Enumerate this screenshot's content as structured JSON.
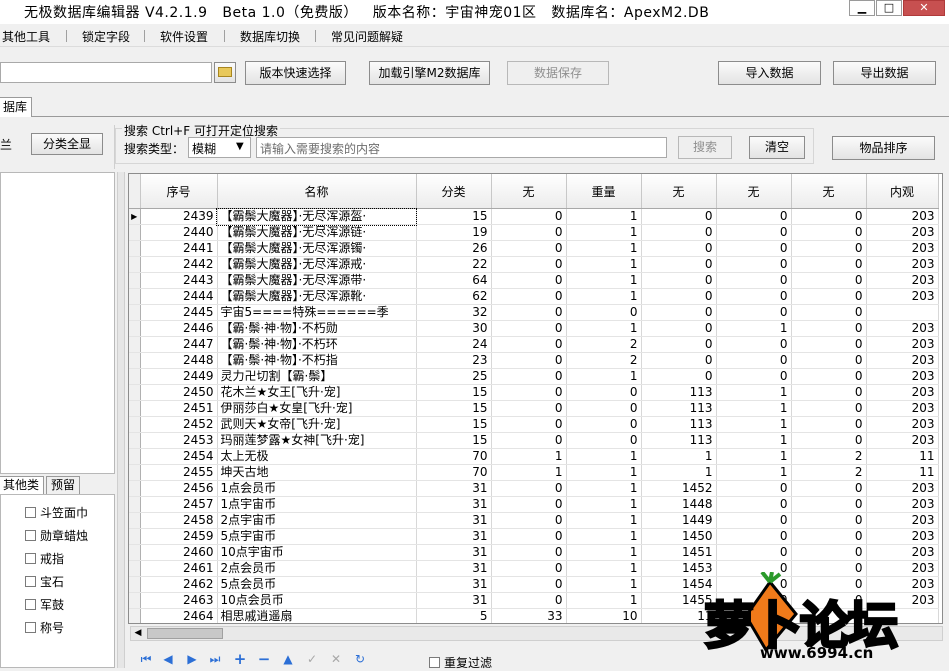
{
  "window": {
    "title": "无极数据库编辑器 V4.2.1.9   Beta 1.0（免费版）   版本名称：宇宙神宠01区   数据库名：ApexM2.DB",
    "minimize": "▁",
    "maximize": "□",
    "close": "✕"
  },
  "menu": [
    "其他工具",
    "锁定字段",
    "软件设置",
    "数据库切换",
    "常见问题解疑"
  ],
  "toolbar": {
    "folder_icon": "folder-icon",
    "version_select": "版本快速选择",
    "load_engine": "加载引擎M2数据库",
    "save_data": "数据保存",
    "import": "导入数据",
    "export": "导出数据"
  },
  "tab_db": "据库",
  "left_panel": {
    "label_fragment": "兰",
    "show_all": "分类全显",
    "tabs": [
      "其他类",
      "预留"
    ],
    "checkboxes": [
      "斗笠面巾",
      "勋章蜡烛",
      "戒指",
      "宝石",
      "军鼓",
      "称号"
    ]
  },
  "search": {
    "hint": "搜索  Ctrl+F 可打开定位搜索",
    "type_label": "搜索类型：",
    "type_value": "模糊",
    "placeholder": "请输入需要搜索的内容",
    "search_button": "搜索",
    "clear_button": "清空",
    "sort_button": "物品排序"
  },
  "table": {
    "columns": [
      "序号",
      "名称",
      "分类",
      "无",
      "重量",
      "无",
      "无",
      "无",
      "内观"
    ],
    "rows": [
      [
        "2439",
        "【霸鬃大魔器】·无尽浑源盔·",
        "15",
        "0",
        "1",
        "0",
        "0",
        "0",
        "203"
      ],
      [
        "2440",
        "【霸鬃大魔器】·无尽浑源链·",
        "19",
        "0",
        "1",
        "0",
        "0",
        "0",
        "203"
      ],
      [
        "2441",
        "【霸鬃大魔器】·无尽浑源镯·",
        "26",
        "0",
        "1",
        "0",
        "0",
        "0",
        "203"
      ],
      [
        "2442",
        "【霸鬃大魔器】·无尽浑源戒·",
        "22",
        "0",
        "1",
        "0",
        "0",
        "0",
        "203"
      ],
      [
        "2443",
        "【霸鬃大魔器】·无尽浑源带·",
        "64",
        "0",
        "1",
        "0",
        "0",
        "0",
        "203"
      ],
      [
        "2444",
        "【霸鬃大魔器】·无尽浑源靴·",
        "62",
        "0",
        "1",
        "0",
        "0",
        "0",
        "203"
      ],
      [
        "2445",
        "宇宙5====特殊======季",
        "32",
        "0",
        "0",
        "0",
        "0",
        "0",
        ""
      ],
      [
        "2446",
        "【霸·鬃·神·物】·不朽勋",
        "30",
        "0",
        "1",
        "0",
        "1",
        "0",
        "203"
      ],
      [
        "2447",
        "【霸·鬃·神·物】·不朽环",
        "24",
        "0",
        "2",
        "0",
        "0",
        "0",
        "203"
      ],
      [
        "2448",
        "【霸·鬃·神·物】·不朽指",
        "23",
        "0",
        "2",
        "0",
        "0",
        "0",
        "203"
      ],
      [
        "2449",
        "灵力卍切割【霸·鬃】",
        "25",
        "0",
        "1",
        "0",
        "0",
        "0",
        "203"
      ],
      [
        "2450",
        "花木兰★女王[飞升·宠]",
        "15",
        "0",
        "0",
        "113",
        "1",
        "0",
        "203"
      ],
      [
        "2451",
        "伊丽莎白★女皇[飞升·宠]",
        "15",
        "0",
        "0",
        "113",
        "1",
        "0",
        "203"
      ],
      [
        "2452",
        "武则天★女帝[飞升·宠]",
        "15",
        "0",
        "0",
        "113",
        "1",
        "0",
        "203"
      ],
      [
        "2453",
        "玛丽莲梦露★女神[飞升·宠]",
        "15",
        "0",
        "0",
        "113",
        "1",
        "0",
        "203"
      ],
      [
        "2454",
        "太上无极",
        "70",
        "1",
        "1",
        "1",
        "1",
        "2",
        "11"
      ],
      [
        "2455",
        "坤天古地",
        "70",
        "1",
        "1",
        "1",
        "1",
        "2",
        "11"
      ],
      [
        "2456",
        "1点会员币",
        "31",
        "0",
        "1",
        "1452",
        "0",
        "0",
        "203"
      ],
      [
        "2457",
        "1点宇宙币",
        "31",
        "0",
        "1",
        "1448",
        "0",
        "0",
        "203"
      ],
      [
        "2458",
        "2点宇宙币",
        "31",
        "0",
        "1",
        "1449",
        "0",
        "0",
        "203"
      ],
      [
        "2459",
        "5点宇宙币",
        "31",
        "0",
        "1",
        "1450",
        "0",
        "0",
        "203"
      ],
      [
        "2460",
        "10点宇宙币",
        "31",
        "0",
        "1",
        "1451",
        "0",
        "0",
        "203"
      ],
      [
        "2461",
        "2点会员币",
        "31",
        "0",
        "1",
        "1453",
        "0",
        "0",
        "203"
      ],
      [
        "2462",
        "5点会员币",
        "31",
        "0",
        "1",
        "1454",
        "0",
        "0",
        "203"
      ],
      [
        "2463",
        "10点会员币",
        "31",
        "0",
        "1",
        "1455",
        "0",
        "0",
        "203"
      ],
      [
        "2464",
        "相思戚逍遥扇",
        "5",
        "33",
        "10",
        "11",
        "",
        "",
        ""
      ]
    ]
  },
  "bottom": {
    "repeat_filter": "重复过滤",
    "nav_icons": [
      "first-icon",
      "prior-icon",
      "next-icon",
      "last-icon",
      "insert-icon",
      "delete-icon",
      "edit-icon",
      "post-icon",
      "cancel-icon",
      "refresh-icon"
    ]
  },
  "watermark": {
    "text": "萝卜论坛",
    "url": "www.6994.cn"
  }
}
